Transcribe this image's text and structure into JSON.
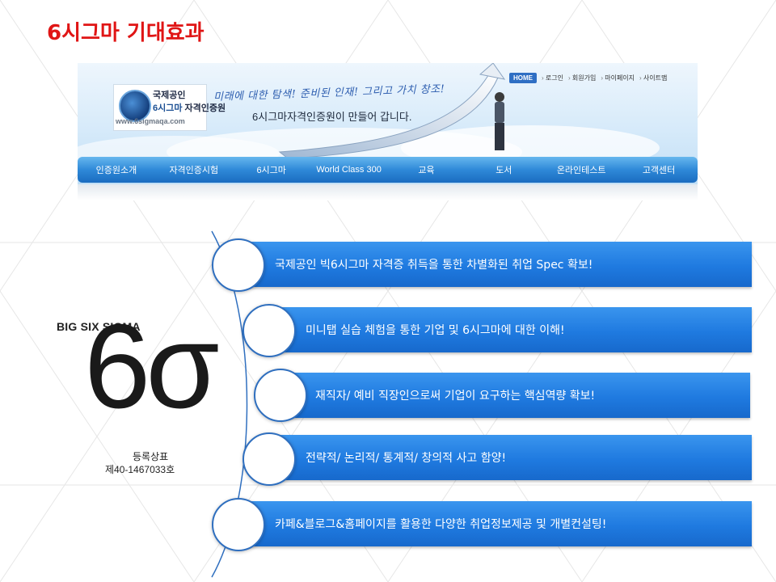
{
  "slide": {
    "title": "6시그마 기대효과"
  },
  "site": {
    "logo": {
      "line1": "국제공인",
      "line2_accent": "6시그마",
      "line2_rest": " 자격인증원",
      "url": "www.6sigmaqa.com"
    },
    "slogan_handwritten": "미래에 대한 탐색! 준비된 인재! 그리고 가치 창조!",
    "slogan_main": "6시그마자격인증원이 만들어 갑니다.",
    "top_nav": {
      "home": "HOME",
      "items": [
        "로그인",
        "회원가입",
        "마이페이지",
        "사이트맵"
      ]
    },
    "main_nav": [
      "인증원소개",
      "자격인증시험",
      "6시그마",
      "World Class 300",
      "교육",
      "도서",
      "온라인테스트",
      "고객센터"
    ]
  },
  "brand": {
    "label": "BIG SIX SIGMA",
    "mark": "6σ",
    "trademark_label": "등록상표",
    "trademark_number": "제40-1467033호"
  },
  "benefits": [
    "국제공인 빅6시그마 자격증 취득을 통한 차별화된 취업 Spec 확보!",
    "미니탭 실습 체험을 통한 기업 및 6시그마에 대한 이해!",
    "재직자/ 예비 직장인으로써 기업이 요구하는 핵심역량 확보!",
    "전략적/ 논리적/ 통계적/ 창의적 사고 함양!",
    "카페&블로그&홈페이지를 활용한 다양한 취업정보제공 및 개별컨설팅!"
  ],
  "colors": {
    "title": "#e01515",
    "bar": "#1f7ae0",
    "nav": "#2f89d8",
    "circle_border": "#2f6fbf"
  }
}
